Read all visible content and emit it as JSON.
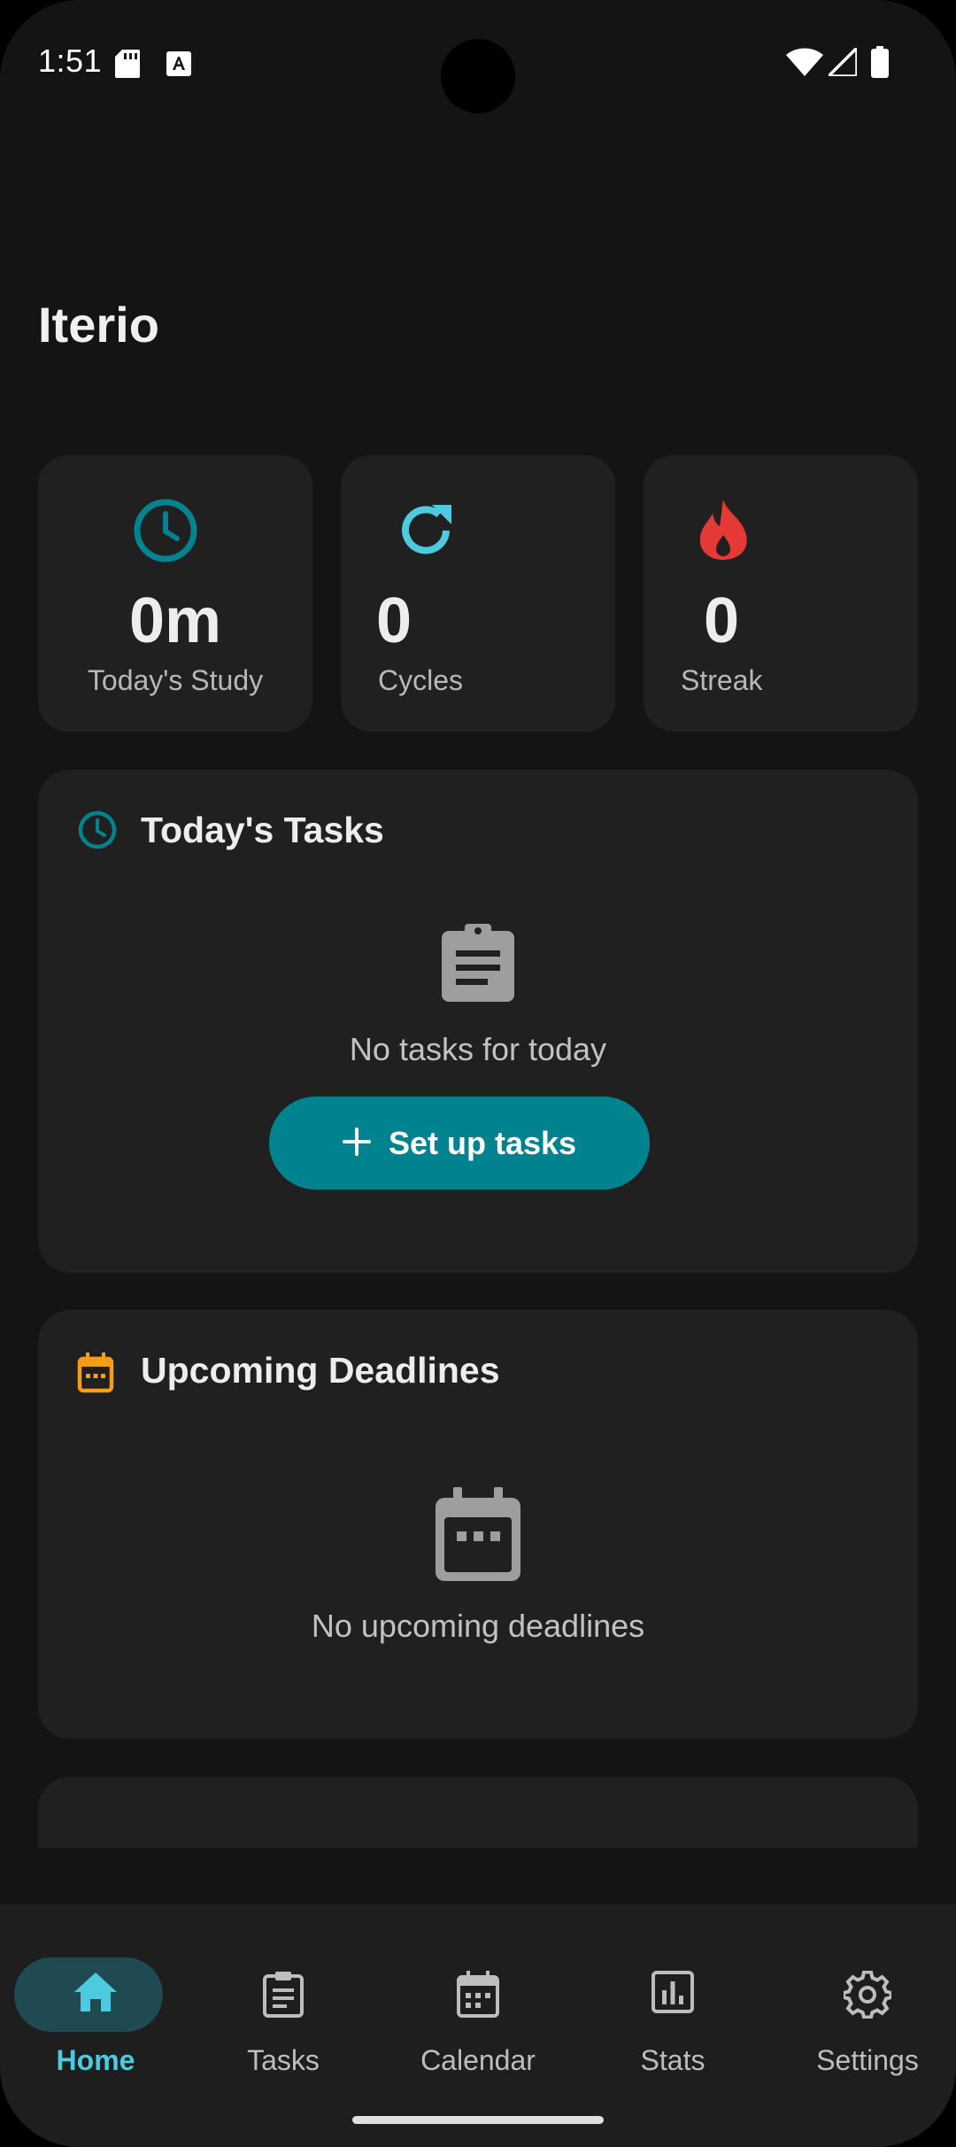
{
  "status_bar": {
    "time": "1:51"
  },
  "app": {
    "title": "Iterio"
  },
  "stats": [
    {
      "value": "0m",
      "label": "Today's Study",
      "icon": "clock-icon",
      "color": "#00838f"
    },
    {
      "value": "0",
      "label": "Cycles",
      "icon": "refresh-icon",
      "color": "#4dc9e0"
    },
    {
      "value": "0",
      "label": "Streak",
      "icon": "fire-icon",
      "color": "#e53935"
    }
  ],
  "todays_tasks": {
    "title": "Today's Tasks",
    "empty_text": "No tasks for today",
    "button_label": "Set up tasks",
    "accent": "#00838f"
  },
  "deadlines": {
    "title": "Upcoming Deadlines",
    "empty_text": "No upcoming deadlines",
    "accent": "#f59c1a"
  },
  "bottom_nav": {
    "items": [
      {
        "label": "Home",
        "icon": "home-icon",
        "active": true
      },
      {
        "label": "Tasks",
        "icon": "clipboard-icon",
        "active": false
      },
      {
        "label": "Calendar",
        "icon": "calendar-icon",
        "active": false
      },
      {
        "label": "Stats",
        "icon": "bar-chart-icon",
        "active": false
      },
      {
        "label": "Settings",
        "icon": "gear-icon",
        "active": false
      }
    ],
    "active_color": "#4dc9e0"
  }
}
